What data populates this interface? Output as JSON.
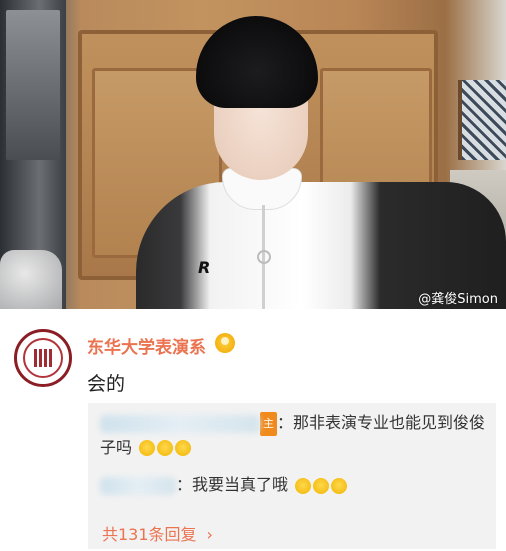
{
  "photo": {
    "watermark": "@龚俊Simon",
    "jacket_logo": "R"
  },
  "comment": {
    "username": "东华大学表演系",
    "username_color": "#eb7350",
    "text": "会的",
    "vip_icon": "crown-badge-icon"
  },
  "replies": {
    "items": [
      {
        "author_badge": "主",
        "text": "：那非表演专业也能见到俊俊子吗",
        "emoji_icon": "grimace-emoji-icon"
      },
      {
        "text": "：我要当真了哦",
        "emoji_icon": "smile-emoji-icon"
      }
    ],
    "more_label": "共131条回复",
    "more_chevron": "›"
  }
}
